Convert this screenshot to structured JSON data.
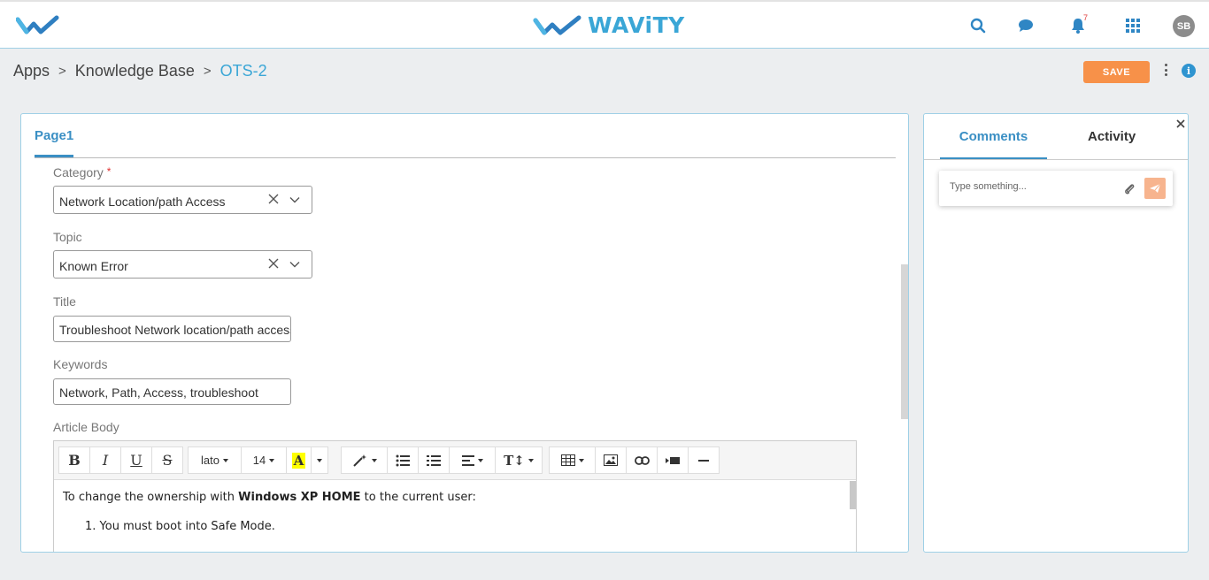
{
  "header": {
    "brand": "WAViTY",
    "notification_count": "7",
    "avatar_initials": "SB"
  },
  "breadcrumb": {
    "items": [
      "Apps",
      "Knowledge Base",
      "OTS-2"
    ],
    "separator": ">"
  },
  "actions": {
    "save_label": "SAVE"
  },
  "form": {
    "page_tab": "Page1",
    "category": {
      "label": "Category",
      "required_mark": "*",
      "value": "Network Location/path Access"
    },
    "topic": {
      "label": "Topic",
      "value": "Known Error"
    },
    "title": {
      "label": "Title",
      "value": "Troubleshoot Network location/path access"
    },
    "keywords": {
      "label": "Keywords",
      "value": "Network, Path, Access, troubleshoot"
    },
    "article_body": {
      "label": "Article Body"
    }
  },
  "editor": {
    "font_family": "lato",
    "font_size": "14",
    "content": {
      "intro_before": "To change the ownership with ",
      "intro_bold": "Windows XP HOME",
      "intro_after": " to the current user:",
      "list_item_1": "1. You must boot into Safe Mode."
    }
  },
  "side_panel": {
    "tabs": [
      "Comments",
      "Activity"
    ],
    "comment_placeholder": "Type something..."
  },
  "colors": {
    "accent": "#3aa6d6",
    "save": "#f79149",
    "send": "#f7b48e",
    "background": "#eceef0"
  }
}
